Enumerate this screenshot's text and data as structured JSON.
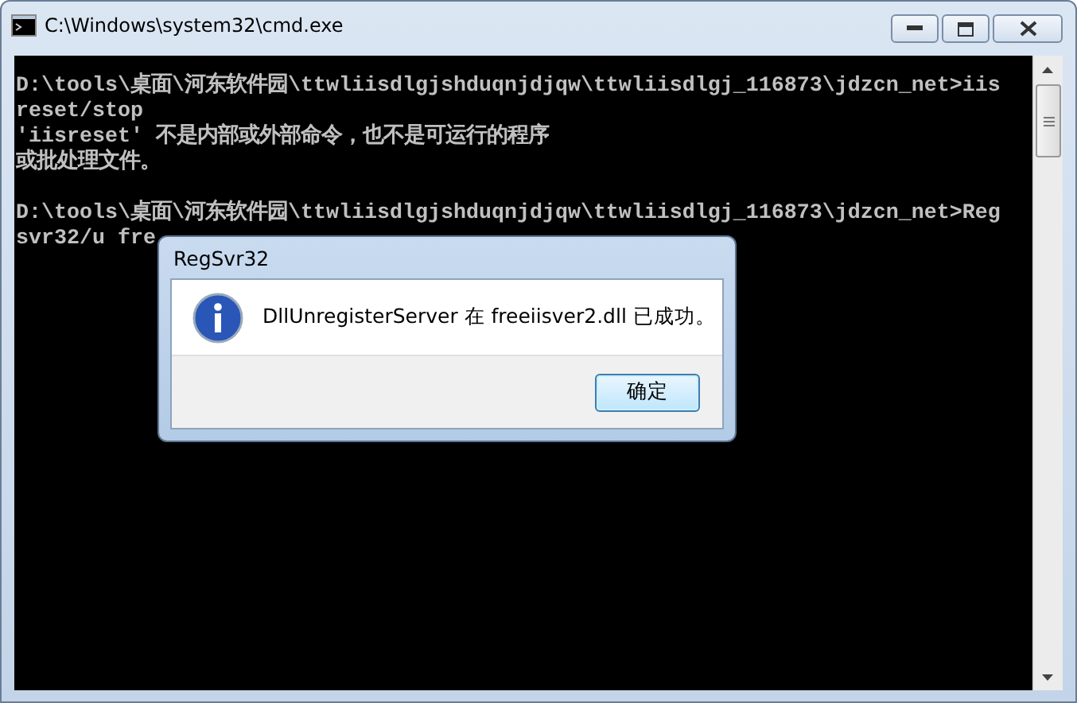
{
  "window": {
    "title": "C:\\Windows\\system32\\cmd.exe"
  },
  "console": {
    "blocks": [
      [
        "D:\\tools\\桌面\\河东软件园\\ttwliisdlgjshduqnjdjqw\\ttwliisdlgj_116873\\jdzcn_net>iis",
        "reset/stop",
        "'iisreset' 不是内部或外部命令，也不是可运行的程序",
        "或批处理文件。"
      ],
      [
        "D:\\tools\\桌面\\河东软件园\\ttwliisdlgjshduqnjdjqw\\ttwliisdlgj_116873\\jdzcn_net>Reg",
        "svr32/u fre"
      ]
    ]
  },
  "dialog": {
    "title": "RegSvr32",
    "message": "DllUnregisterServer 在 freeiisver2.dll 已成功。",
    "buttons": [
      "确定"
    ]
  }
}
